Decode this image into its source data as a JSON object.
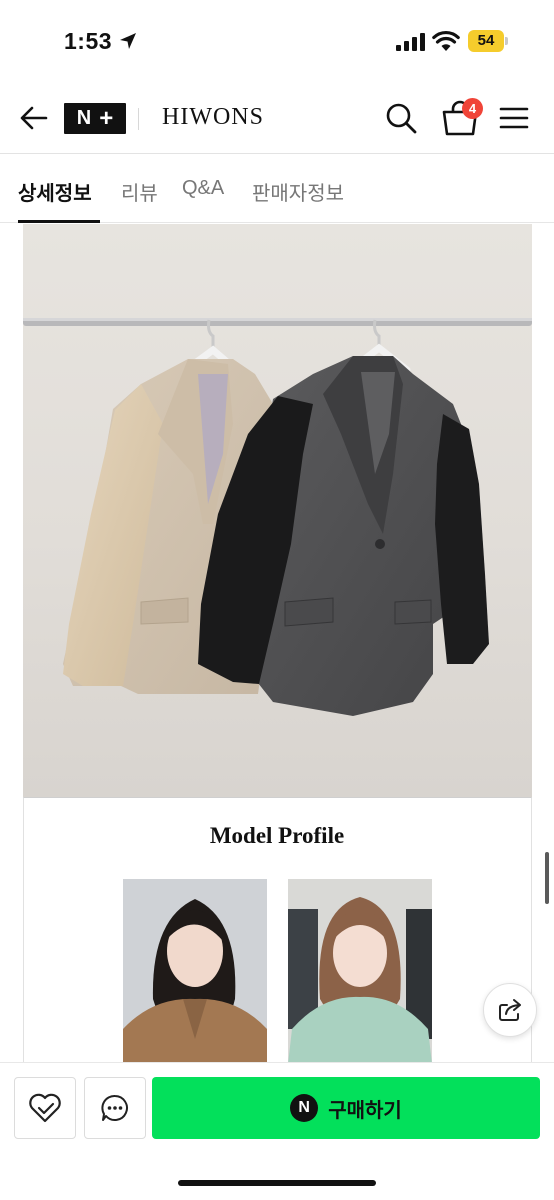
{
  "status_bar": {
    "time": "1:53",
    "battery": "54"
  },
  "topnav": {
    "logo_left": "N",
    "logo_right": "+",
    "store_name": "HIWONS",
    "cart_count": "4"
  },
  "tabs": [
    {
      "label": "상세정보",
      "active": true
    },
    {
      "label": "리뷰",
      "active": false
    },
    {
      "label": "Q&A",
      "active": false
    },
    {
      "label": "판매자정보",
      "active": false
    }
  ],
  "content": {
    "profile_title": "Model Profile"
  },
  "bottom_bar": {
    "pay_icon_letter": "N",
    "buy_label": "구매하기"
  },
  "colors": {
    "buy_green": "#03e05b",
    "badge_red": "#f04438",
    "battery_yellow": "#f5cc2c"
  },
  "icons": [
    "location-arrow-icon",
    "cellular-signal-icon",
    "wifi-icon",
    "battery-icon",
    "back-arrow-icon",
    "search-icon",
    "shopping-bag-icon",
    "hamburger-menu-icon",
    "share-icon",
    "heart-like-icon",
    "chat-bubble-icon"
  ]
}
